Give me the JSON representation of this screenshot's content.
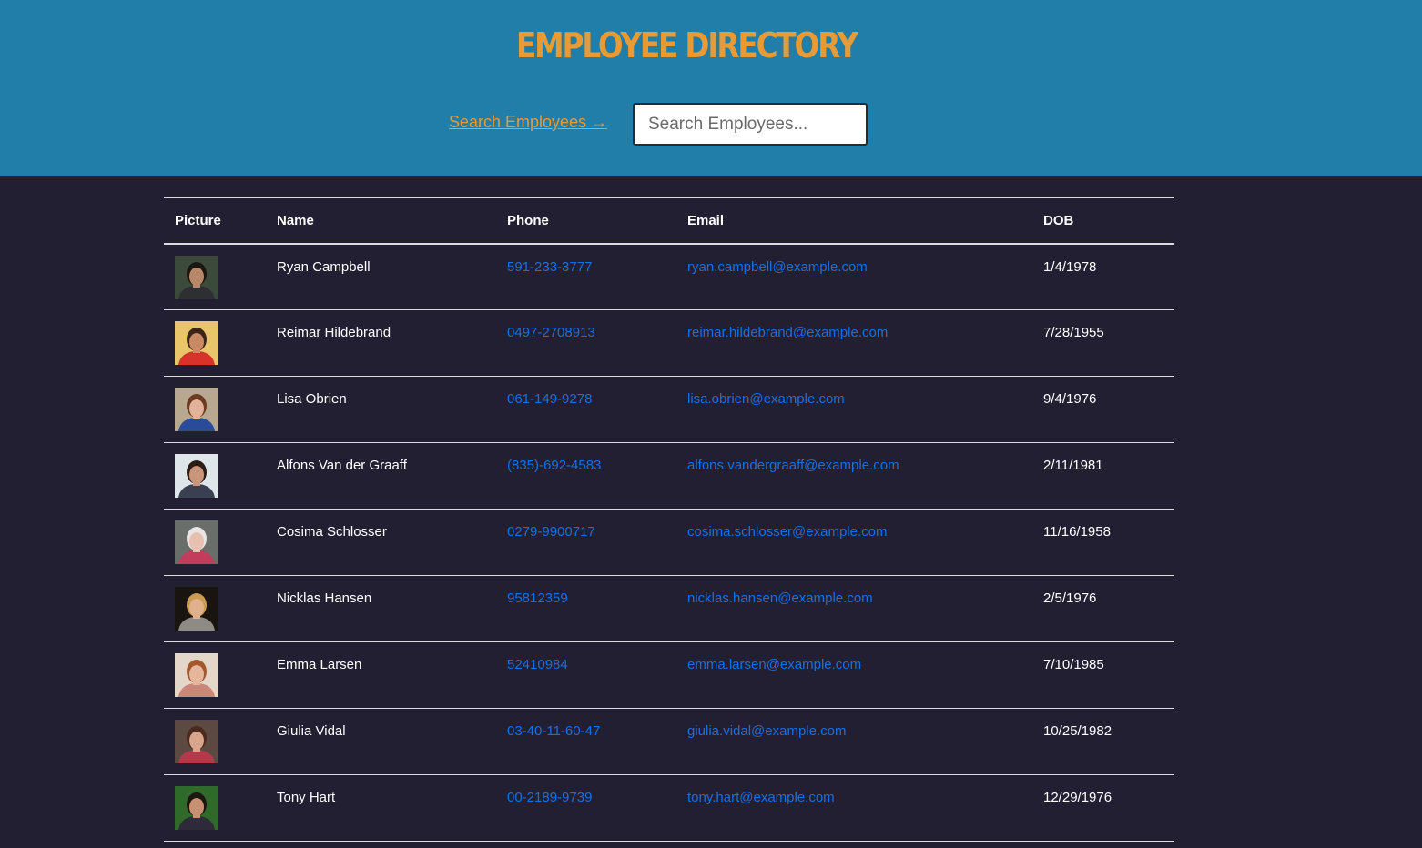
{
  "header": {
    "title": "EMPLOYEE DIRECTORY",
    "search_link": "Search Employees →",
    "search_placeholder": "Search Employees..."
  },
  "colors": {
    "header_bg": "#207ea8",
    "page_bg": "#221f32",
    "accent": "#e89a35",
    "link": "#1a6fe0"
  },
  "table": {
    "columns": [
      "Picture",
      "Name",
      "Phone",
      "Email",
      "DOB"
    ],
    "rows": [
      {
        "name": "Ryan Campbell",
        "phone": "591-233-3777",
        "email": "ryan.campbell@example.com",
        "dob": "1/4/1978",
        "avatar": {
          "bg": "#3b4a3a",
          "skin": "#b8876a",
          "hair": "#1c1512",
          "shirt": "#2d2f33"
        }
      },
      {
        "name": "Reimar Hildebrand",
        "phone": "0497-2708913",
        "email": "reimar.hildebrand@example.com",
        "dob": "7/28/1955",
        "avatar": {
          "bg": "#e9c66a",
          "skin": "#c98a63",
          "hair": "#3a2618",
          "shirt": "#d8332a"
        }
      },
      {
        "name": "Lisa Obrien",
        "phone": "061-149-9278",
        "email": "lisa.obrien@example.com",
        "dob": "9/4/1976",
        "avatar": {
          "bg": "#b9a890",
          "skin": "#e2b39a",
          "hair": "#6b3b24",
          "shirt": "#2a4a9a"
        }
      },
      {
        "name": "Alfons Van der Graaff",
        "phone": "(835)-692-4583",
        "email": "alfons.vandergraaff@example.com",
        "dob": "2/11/1981",
        "avatar": {
          "bg": "#dfe6ea",
          "skin": "#c9967a",
          "hair": "#2a1e17",
          "shirt": "#3a3f52"
        }
      },
      {
        "name": "Cosima Schlosser",
        "phone": "0279-9900717",
        "email": "cosima.schlosser@example.com",
        "dob": "11/16/1958",
        "avatar": {
          "bg": "#6a6e6a",
          "skin": "#e8c0b0",
          "hair": "#e9e4e6",
          "shirt": "#c43c5c"
        }
      },
      {
        "name": "Nicklas Hansen",
        "phone": "95812359",
        "email": "nicklas.hansen@example.com",
        "dob": "2/5/1976",
        "avatar": {
          "bg": "#1a1410",
          "skin": "#e0b08c",
          "hair": "#c99b52",
          "shirt": "#8e8a86"
        }
      },
      {
        "name": "Emma Larsen",
        "phone": "52410984",
        "email": "emma.larsen@example.com",
        "dob": "7/10/1985",
        "avatar": {
          "bg": "#e4d6c8",
          "skin": "#e6b69c",
          "hair": "#a4582f",
          "shirt": "#c9867a"
        }
      },
      {
        "name": "Giulia Vidal",
        "phone": "03-40-11-60-47",
        "email": "giulia.vidal@example.com",
        "dob": "10/25/1982",
        "avatar": {
          "bg": "#5c4a42",
          "skin": "#d9a48c",
          "hair": "#4a2a1e",
          "shirt": "#b23a4a"
        }
      },
      {
        "name": "Tony Hart",
        "phone": "00-2189-9739",
        "email": "tony.hart@example.com",
        "dob": "12/29/1976",
        "avatar": {
          "bg": "#2f6a2a",
          "skin": "#c89072",
          "hair": "#1e1410",
          "shirt": "#2e2a3a"
        }
      }
    ]
  }
}
